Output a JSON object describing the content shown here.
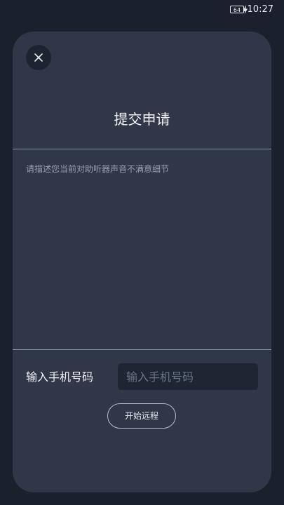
{
  "status_bar": {
    "battery": "64",
    "time": "10:27"
  },
  "dialog": {
    "title": "提交申请",
    "description_placeholder": "请描述您当前对助听器声音不满意细节",
    "phone_label": "输入手机号码",
    "phone_placeholder": "输入手机号码",
    "start_button": "开始远程"
  },
  "colors": {
    "background": "#1a202c",
    "card": "#2f3749",
    "input": "#1e2533",
    "divider": "#8a93a8"
  },
  "icons": {
    "close": "close-icon",
    "charging": "bolt-icon"
  }
}
